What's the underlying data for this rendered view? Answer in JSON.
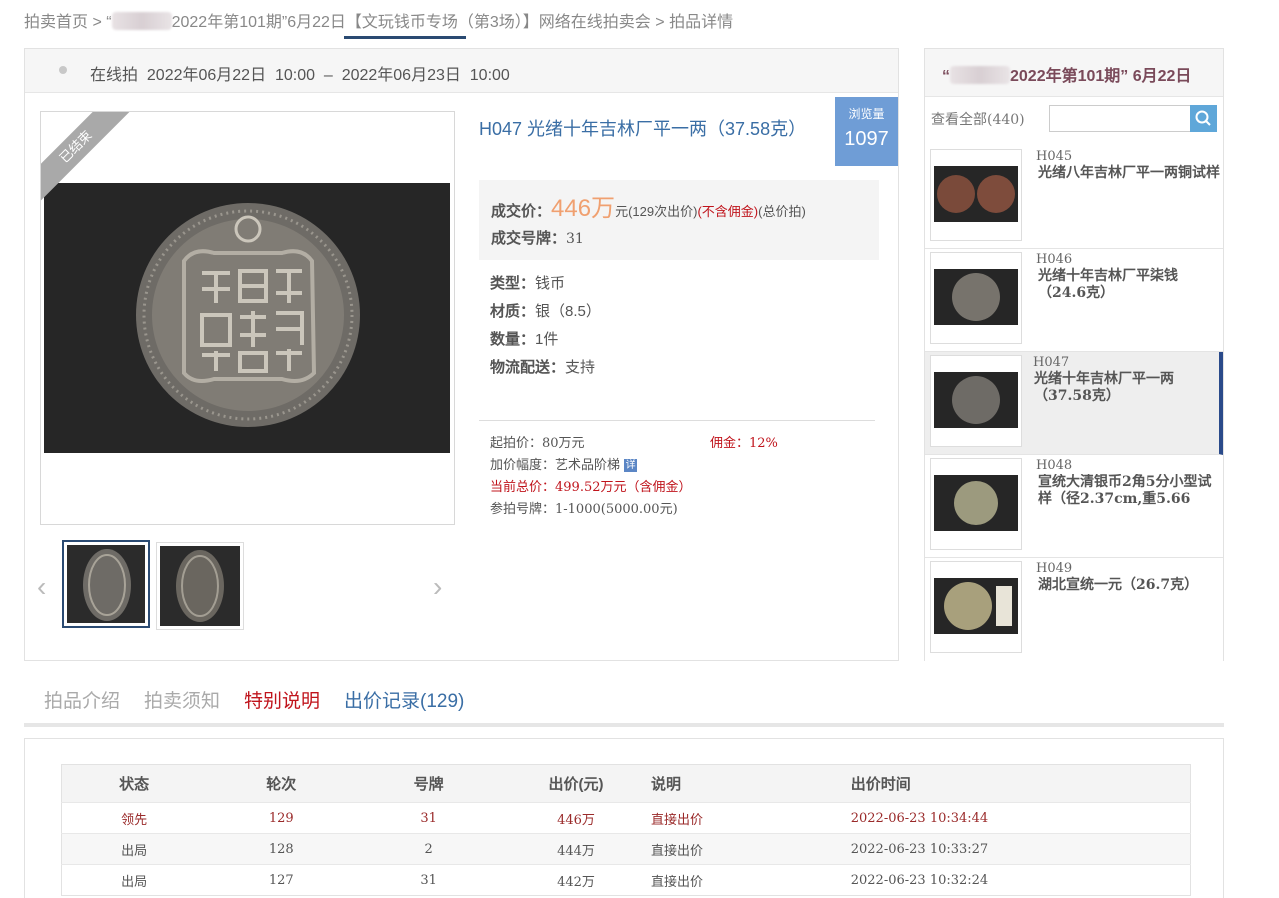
{
  "breadcrumb": {
    "home": "拍卖首页",
    "sep": ">",
    "auction_prefix": "“",
    "auction_name": "2022年第101期”6月22日【文玩钱币专场（第3场）】网络在线拍卖会",
    "current": "拍品详情"
  },
  "session": {
    "text": "在线拍  2022年06月22日  10:00  –  2022年06月23日  10:00"
  },
  "ribbon": "已结束",
  "lot": {
    "title": "H047 光绪十年吉林厂平一两（37.58克）",
    "views_label": "浏览量",
    "views": "1097"
  },
  "price": {
    "label": "成交价：",
    "value": "446万",
    "unit": "元",
    "bids": "(129次出价)",
    "no_commission": "(不含佣金)",
    "total": "(总价拍)",
    "deal_label": "成交号牌：",
    "deal_value": "31"
  },
  "info": [
    {
      "k": "类型：",
      "v": "钱币"
    },
    {
      "k": "材质：",
      "v": "银（8.5）"
    },
    {
      "k": "数量：",
      "v": "1件"
    },
    {
      "k": "物流配送：",
      "v": "支持"
    }
  ],
  "terms": {
    "start": "起拍价：80万元",
    "commission": "佣金：12%",
    "increment": "加价幅度：艺术品阶梯",
    "detail_badge": "详",
    "current_total": "当前总价：499.52万元（含佣金）",
    "paddle": "参拍号牌：1-1000(5000.00元)"
  },
  "side": {
    "title_prefix": "“",
    "title": "2022年第101期” 6月22日",
    "view_all": "查看全部(440)",
    "search_placeholder": "",
    "items": [
      {
        "code": "H045",
        "name": "光绪八年吉林厂平一两铜试样"
      },
      {
        "code": "H046",
        "name": "光绪十年吉林厂平柒钱（24.6克）"
      },
      {
        "code": "H047",
        "name": "光绪十年吉林厂平一两（37.58克）"
      },
      {
        "code": "H048",
        "name": "宣统大清银币2角5分小型试样（径2.37cm,重5.66"
      },
      {
        "code": "H049",
        "name": "湖北宣统一元（26.7克）"
      }
    ]
  },
  "tabs": {
    "intro": "拍品介绍",
    "notice": "拍卖须知",
    "special": "特别说明",
    "bids": "出价记录(129)"
  },
  "bid_table": {
    "headers": [
      "状态",
      "轮次",
      "号牌",
      "出价(元)",
      "说明",
      "出价时间"
    ],
    "rows": [
      [
        "领先",
        "129",
        "31",
        "446万",
        "直接出价",
        "2022-06-23 10:34:44"
      ],
      [
        "出局",
        "128",
        "2",
        "444万",
        "直接出价",
        "2022-06-23 10:33:27"
      ],
      [
        "出局",
        "127",
        "31",
        "442万",
        "直接出价",
        "2022-06-23 10:32:24"
      ]
    ]
  },
  "colors": {
    "accent_blue": "#3a6ea5",
    "price_orange": "#f0a070",
    "alert_red": "#c0141c",
    "views_badge": "#6f9dd6"
  }
}
